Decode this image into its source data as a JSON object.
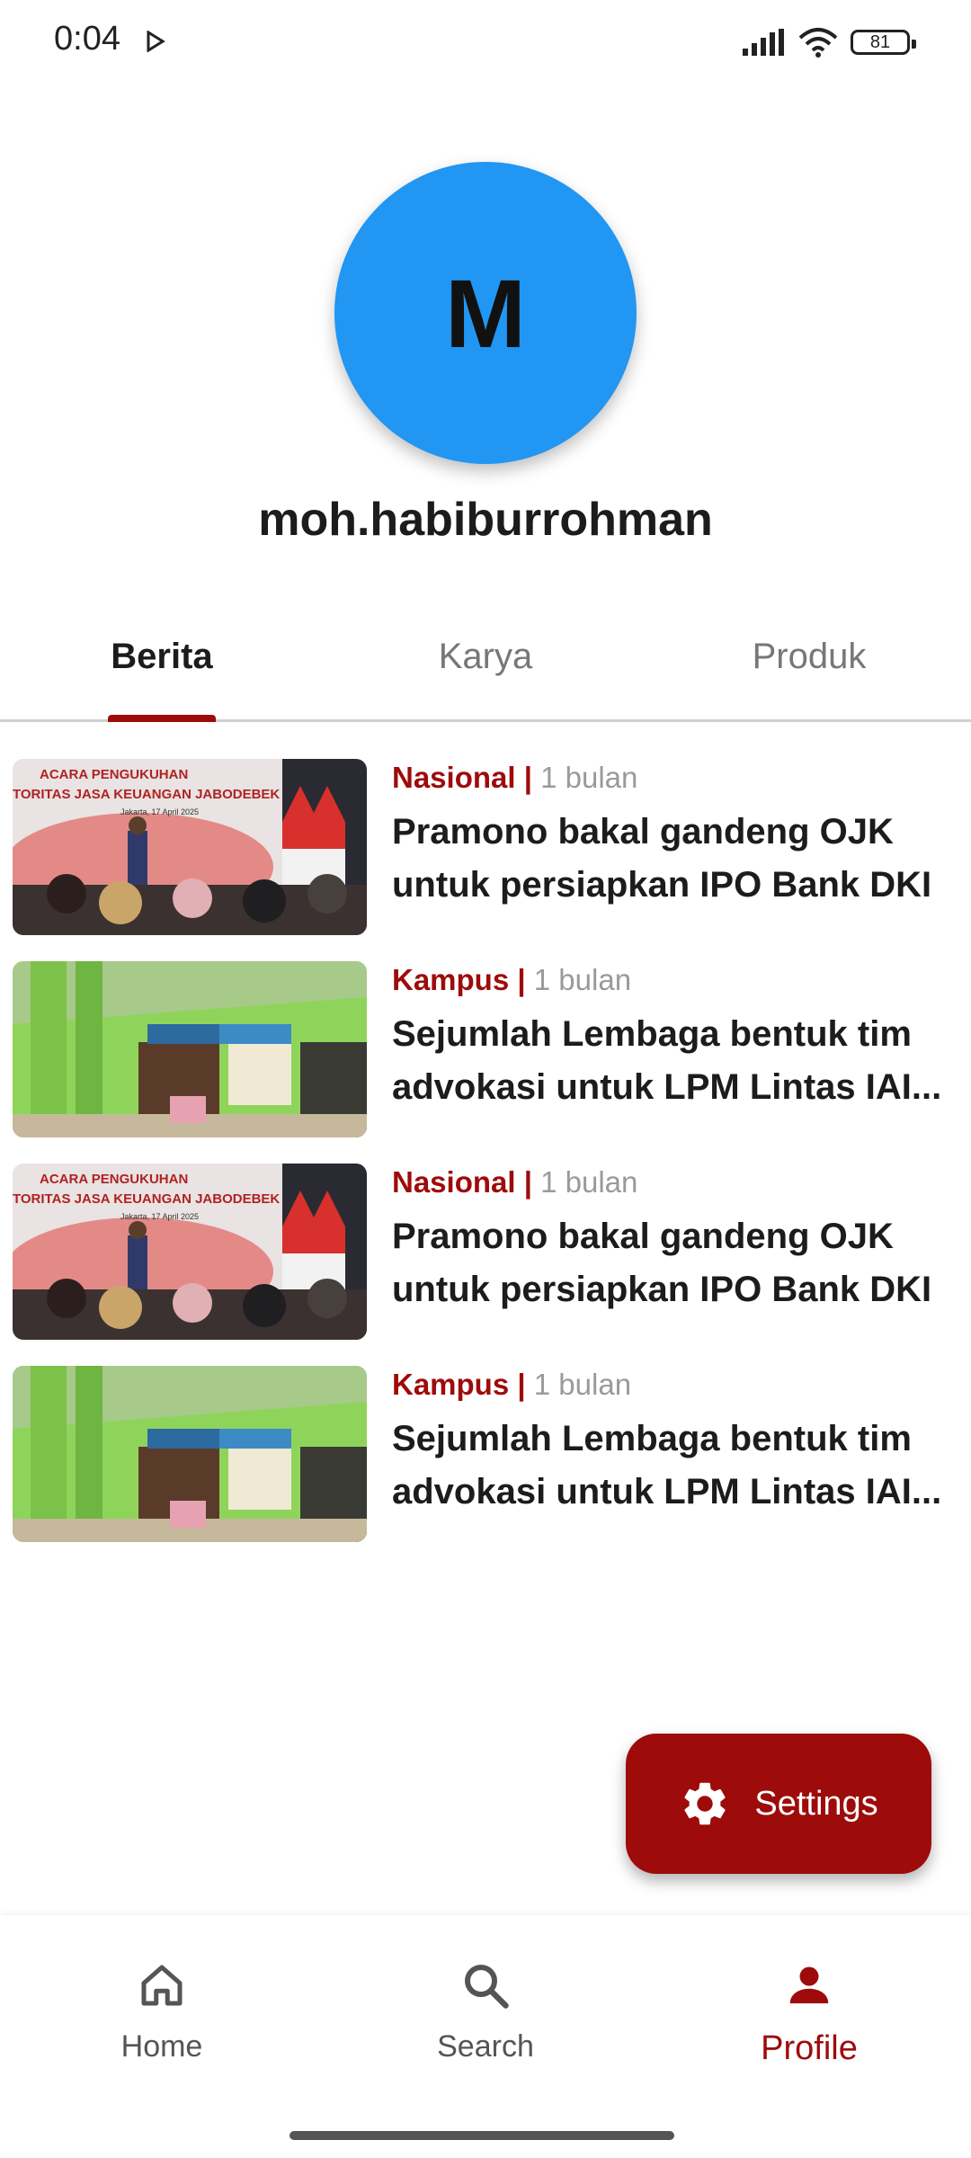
{
  "status": {
    "time": "0:04",
    "battery": "81"
  },
  "profile": {
    "initial": "M",
    "username": "moh.habiburrohman"
  },
  "tabs": [
    {
      "label": "Berita",
      "active": true
    },
    {
      "label": "Karya",
      "active": false
    },
    {
      "label": "Produk",
      "active": false
    }
  ],
  "articles": [
    {
      "category": "Nasional",
      "separator": "|",
      "time": "1 bulan",
      "title": "Pramono bakal gandeng OJK untuk persiapkan IPO Bank DKI",
      "thumb_caption_1": "ACARA PENGUKUHAN",
      "thumb_caption_2": "TORITAS JASA KEUANGAN JABODEBEK",
      "thumb_caption_3": "Jakarta, 17 April 2025"
    },
    {
      "category": "Kampus",
      "separator": "|",
      "time": "1 bulan",
      "title": "Sejumlah Lembaga bentuk tim advokasi untuk LPM Lintas IAI..."
    },
    {
      "category": "Nasional",
      "separator": "|",
      "time": "1 bulan",
      "title": "Pramono bakal gandeng OJK untuk persiapkan IPO Bank DKI",
      "thumb_caption_1": "ACARA PENGUKUHAN",
      "thumb_caption_2": "TORITAS JASA KEUANGAN JABODEBEK",
      "thumb_caption_3": "Jakarta, 17 April 2025"
    },
    {
      "category": "Kampus",
      "separator": "|",
      "time": "1 bulan",
      "title": "Sejumlah Lembaga bentuk tim advokasi untuk LPM Lintas IAI..."
    }
  ],
  "fab": {
    "label": "Settings",
    "icon": "gear-icon"
  },
  "bottom_nav": [
    {
      "label": "Home",
      "icon": "home-icon"
    },
    {
      "label": "Search",
      "icon": "search-icon"
    },
    {
      "label": "Profile",
      "icon": "person-icon",
      "active": true
    }
  ],
  "colors": {
    "accent": "#9e0b0b",
    "avatar": "#2196f3"
  }
}
